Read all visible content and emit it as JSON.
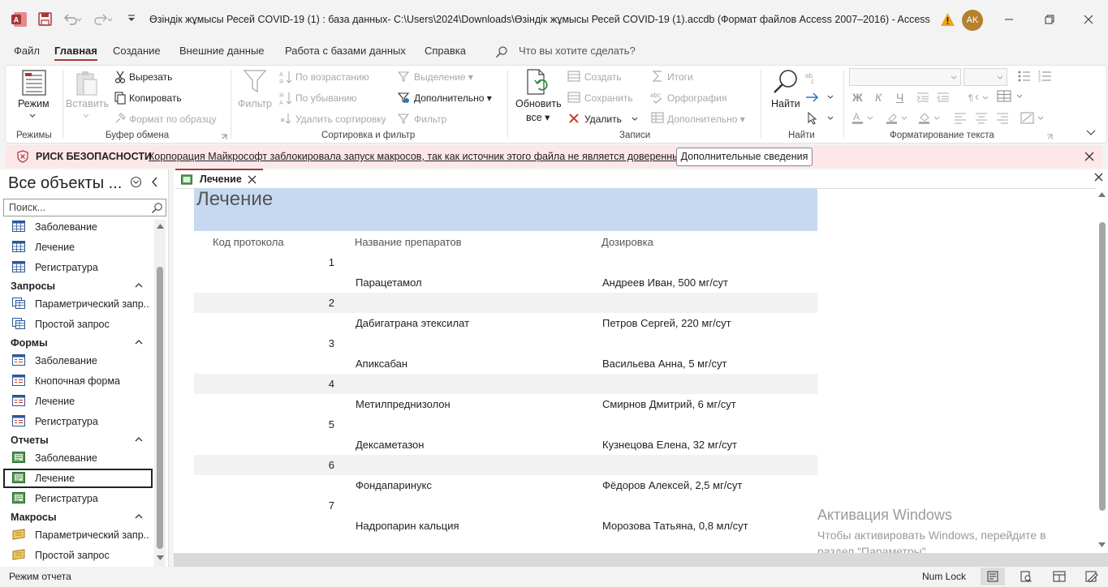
{
  "window": {
    "title": "Өзіндік жұмысы Ресей COVID-19 (1) : база данных- C:\\Users\\2024\\Downloads\\Өзіндік жұмысы Ресей COVID-19 (1).accdb (Формат файлов Access 2007–2016)  -  Access",
    "user_initials": "AK"
  },
  "menu": {
    "tabs": [
      "Файл",
      "Главная",
      "Создание",
      "Внешние данные",
      "Работа с базами данных",
      "Справка"
    ],
    "active_tab": "Главная",
    "search_placeholder": "Что вы хотите сделать?"
  },
  "ribbon": {
    "views": {
      "label": "Режим",
      "group": "Режимы"
    },
    "clipboard": {
      "paste": "Вставить",
      "cut": "Вырезать",
      "copy": "Копировать",
      "format_painter": "Формат по образцу",
      "group": "Буфер обмена"
    },
    "sort_filter": {
      "filter": "Фильтр",
      "ascending": "По возрастанию",
      "descending": "По убыванию",
      "remove_sort": "Удалить сортировку",
      "selection": "Выделение",
      "advanced": "Дополнительно",
      "toggle_filter": "Фильтр",
      "group": "Сортировка и фильтр"
    },
    "records": {
      "refresh_line1": "Обновить",
      "refresh_line2": "все",
      "new": "Создать",
      "save": "Сохранить",
      "delete": "Удалить",
      "totals": "Итоги",
      "spelling": "Орфография",
      "more": "Дополнительно",
      "group": "Записи"
    },
    "find": {
      "find": "Найти",
      "group": "Найти"
    },
    "text_format": {
      "bold": "Ж",
      "italic": "К",
      "underline": "Ч",
      "group": "Форматирование текста"
    }
  },
  "security_bar": {
    "title": "РИСК БЕЗОПАСНОСТИ",
    "message": "Корпорация Майкрософт заблокировала запуск макросов, так как источник этого файла не является доверенным.",
    "button": "Дополнительные сведения"
  },
  "nav_pane": {
    "title": "Все объекты ...",
    "search_placeholder": "Поиск...",
    "tables": [
      "Заболевание",
      "Лечение",
      "Регистратура"
    ],
    "queries_header": "Запросы",
    "queries": [
      "Параметрический запр...",
      "Простой запрос"
    ],
    "forms_header": "Формы",
    "forms": [
      "Заболевание",
      "Кнопочная форма",
      "Лечение",
      "Регистратура"
    ],
    "reports_header": "Отчеты",
    "reports": [
      "Заболевание",
      "Лечение",
      "Регистратура"
    ],
    "selected": "Лечение",
    "macros_header": "Макросы",
    "macros": [
      "Параметрический запр...",
      "Простой запрос"
    ]
  },
  "document": {
    "tab_label": "Лечение",
    "report_title": "Лечение",
    "columns": [
      "Код протокола",
      "Название препаратов",
      "Дозировка"
    ],
    "rows": [
      {
        "id": "1",
        "drug": "Парацетамол",
        "dose": "Андреев Иван, 500 мг/сут"
      },
      {
        "id": "2",
        "drug": "Дабигатрана этексилат",
        "dose": "Петров Сергей, 220 мг/сут"
      },
      {
        "id": "3",
        "drug": "Апиксабан",
        "dose": "Васильева Анна, 5 мг/сут"
      },
      {
        "id": "4",
        "drug": "Метилпреднизолон",
        "dose": "Смирнов Дмитрий, 6 мг/сут"
      },
      {
        "id": "5",
        "drug": "Дексаметазон",
        "dose": "Кузнецова Елена, 32 мг/сут"
      },
      {
        "id": "6",
        "drug": "Фондапаринукс",
        "dose": "Фёдоров Алексей, 2,5 мг/сут"
      },
      {
        "id": "7",
        "drug": "Надропарин кальция",
        "dose": "Морозова Татьяна, 0,8 мл/сут"
      }
    ]
  },
  "watermark": {
    "line1": "Активация Windows",
    "line2": "Чтобы активировать Windows, перейдите в раздел \"Параметры\"."
  },
  "status_bar": {
    "mode": "Режим отчета",
    "num_lock": "Num Lock"
  },
  "colors": {
    "accent": "#a4373a",
    "report_header": "#c6d9f1",
    "security_bg": "#fde7e9"
  }
}
